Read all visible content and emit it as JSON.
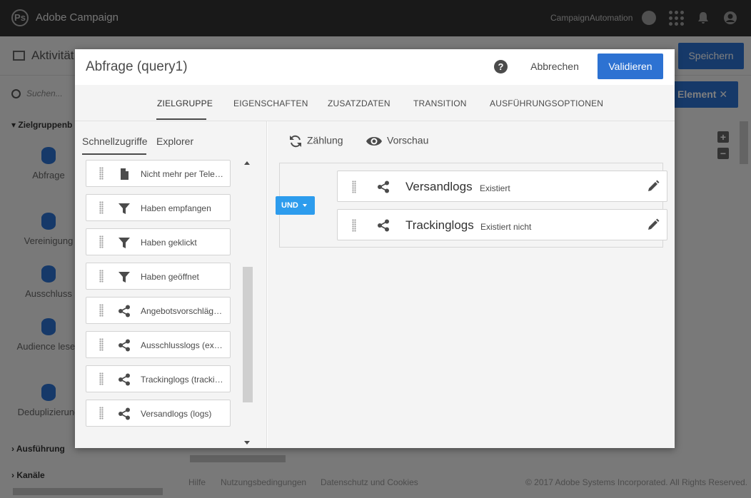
{
  "topbar": {
    "app_title": "Adobe Campaign",
    "instance": "CampaignAutomation",
    "help": "?",
    "logo": "Ps"
  },
  "background": {
    "header_title": "Aktivität",
    "save_label": "Speichern",
    "element_label": "Element",
    "search_placeholder": "Suchen...",
    "sections": [
      "Zielgruppenb",
      "Ausführung",
      "Kanäle"
    ],
    "tools": [
      "Abfrage",
      "Vereinigung",
      "Ausschluss",
      "Audience lesen",
      "Deduplizierung"
    ],
    "footer": {
      "help": "Hilfe",
      "terms": "Nutzungsbedingungen",
      "privacy": "Datenschutz und Cookies",
      "copyright": "© 2017 Adobe Systems Incorporated. All Rights Reserved."
    }
  },
  "modal": {
    "title": "Abfrage (query1)",
    "help": "?",
    "cancel_label": "Abbrechen",
    "validate_label": "Validieren",
    "tabs": [
      "ZIELGRUPPE",
      "EIGENSCHAFTEN",
      "ZUSATZDATEN",
      "TRANSITION",
      "AUSFÜHRUNGSOPTIONEN"
    ],
    "subtabs": [
      "Schnellzugriffe",
      "Explorer"
    ],
    "shortcuts": [
      {
        "label": "Nicht mehr per Telefon kontaktieren",
        "icon": "document-icon"
      },
      {
        "label": "Haben empfangen",
        "icon": "filter-icon"
      },
      {
        "label": "Haben geklickt",
        "icon": "filter-icon"
      },
      {
        "label": "Haben geöffnet",
        "icon": "filter-icon"
      },
      {
        "label": "Angebotsvorschläge (propositions)",
        "icon": "share-icon"
      },
      {
        "label": "Ausschlusslogs (exclusionLogs)",
        "icon": "share-icon"
      },
      {
        "label": "Trackinglogs (trackingLogs)",
        "icon": "share-icon"
      },
      {
        "label": "Versandlogs (logs)",
        "icon": "share-icon"
      }
    ],
    "toolbar": {
      "count_label": "Zählung",
      "preview_label": "Vorschau"
    },
    "operator": "UND",
    "conditions": [
      {
        "name": "Versandlogs",
        "state": "Existiert"
      },
      {
        "name": "Trackinglogs",
        "state": "Existiert nicht"
      }
    ]
  }
}
